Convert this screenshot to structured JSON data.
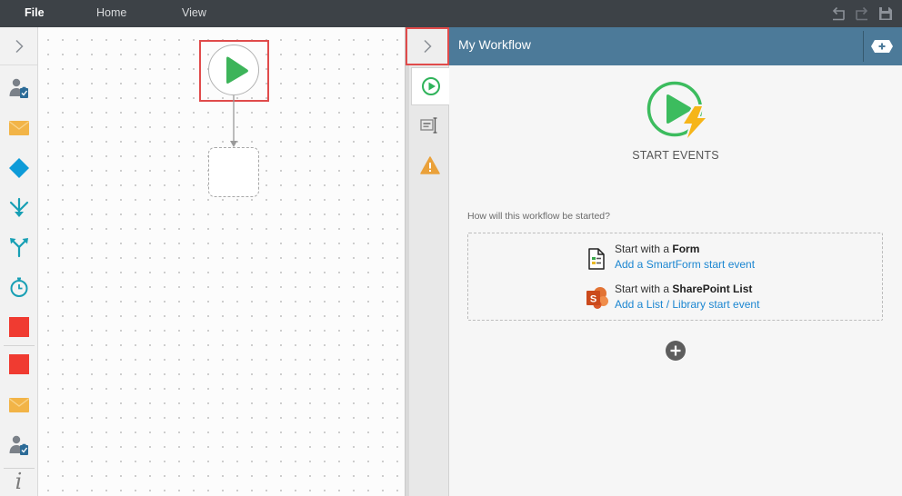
{
  "app": {
    "menu": [
      {
        "id": "file",
        "label": "File"
      },
      {
        "id": "home",
        "label": "Home"
      },
      {
        "id": "view",
        "label": "View"
      }
    ],
    "quick_actions": [
      {
        "icon": "undo-icon"
      },
      {
        "icon": "redo-icon"
      },
      {
        "icon": "save-icon"
      }
    ]
  },
  "palette": {
    "toggle_icon": "chevron-right-icon",
    "items": [
      {
        "icon": "user-task-icon"
      },
      {
        "icon": "email-icon"
      },
      {
        "icon": "decision-icon"
      },
      {
        "icon": "merge-icon"
      },
      {
        "icon": "split-icon"
      },
      {
        "icon": "timer-icon"
      },
      {
        "icon": "end-icon"
      },
      {
        "icon": "end-icon"
      },
      {
        "icon": "email-icon"
      },
      {
        "icon": "user-task-icon"
      }
    ],
    "info_glyph": "i"
  },
  "canvas": {
    "nodes": [
      {
        "type": "start",
        "icon": "play-icon",
        "highlighted": true
      },
      {
        "type": "placeholder"
      }
    ],
    "connectors": [
      {
        "from": "start",
        "to": "placeholder"
      }
    ]
  },
  "panel": {
    "toggle_icon": "chevron-right-icon",
    "toggle_highlighted": true,
    "title": "My Workflow",
    "header_action_icon": "add-icon",
    "tabs": [
      {
        "icon": "start-event-icon",
        "active": true
      },
      {
        "icon": "properties-icon",
        "active": false
      },
      {
        "icon": "warning-icon",
        "active": false
      }
    ]
  },
  "start_events": {
    "hero_icon": "start-event-lightning-icon",
    "heading": "START EVENTS",
    "question": "How will this workflow be started?",
    "options": [
      {
        "icon": "form-icon",
        "prefix": "Start with a ",
        "emphasis": "Form",
        "link": "Add a SmartForm start event"
      },
      {
        "icon": "sharepoint-icon",
        "logo_letter": "S",
        "prefix": "Start with a ",
        "emphasis": "SharePoint List",
        "link": "Add a List / Library start event"
      }
    ],
    "add_icon": "plus-circle-icon"
  },
  "colors": {
    "top_bar": "#3d4247",
    "panel_header": "#4c7a99",
    "start_green": "#3db45a",
    "link_blue": "#1b86d1",
    "highlight_red": "#e04b4b",
    "lightning_yellow": "#f6b519",
    "warning_orange": "#eaa13a",
    "end_red": "#f03b31",
    "decision_blue": "#0e9bd8",
    "flow_teal": "#179fb4"
  }
}
